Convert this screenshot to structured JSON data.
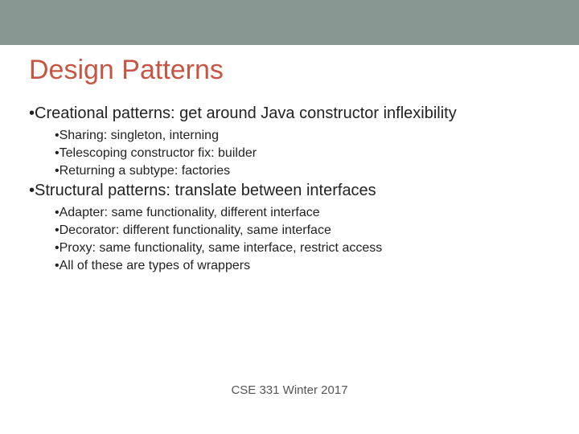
{
  "title": "Design Patterns",
  "sections": [
    {
      "heading": "Creational patterns: get around Java constructor inflexibility",
      "items": [
        "Sharing: singleton, interning",
        "Telescoping constructor fix: builder",
        "Returning a subtype: factories"
      ]
    },
    {
      "heading": "Structural patterns: translate between interfaces",
      "items": [
        "Adapter: same functionality, different interface",
        "Decorator: different functionality, same interface",
        "Proxy: same functionality, same interface, restrict access",
        "All of these are types of wrappers"
      ]
    }
  ],
  "footer": "CSE 331 Winter 2017"
}
